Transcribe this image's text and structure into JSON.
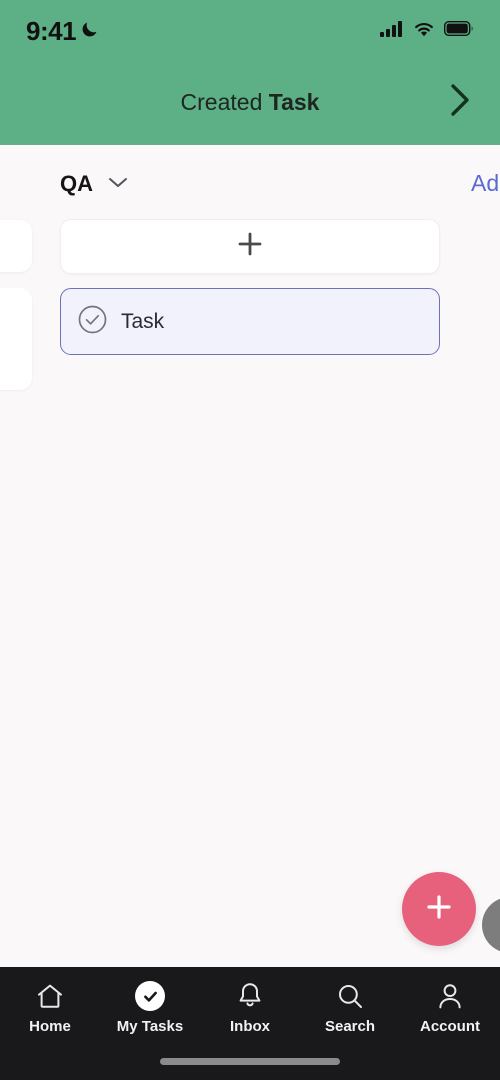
{
  "status_bar": {
    "time": "9:41",
    "moon_icon": "crescent-moon-icon",
    "cellular_icon": "cellular-signal-icon",
    "wifi_icon": "wifi-icon",
    "battery_icon": "battery-full-icon"
  },
  "header": {
    "title_prefix": "Created ",
    "title_emphasis": "Task",
    "chevron_icon": "chevron-right-icon",
    "background_color": "#5daf86"
  },
  "list_header": {
    "section_label": "QA",
    "caret_icon": "chevron-down-icon",
    "add_label": "Add",
    "add_color": "#5b6ad0"
  },
  "board": {
    "add_card": {
      "icon": "plus-icon",
      "label": ""
    },
    "task_card": {
      "label": "Task",
      "status_icon": "check-circle-icon",
      "selected": true,
      "border_color": "#6b72b8",
      "fill_color": "#f2f2fc"
    }
  },
  "fab": {
    "icon": "plus-icon",
    "color": "#e8617c",
    "secondary_color": "#7d7d7d"
  },
  "bottom_nav": {
    "background_color": "#19191c",
    "items": [
      {
        "label": "Home",
        "icon": "home-icon",
        "active": false
      },
      {
        "label": "My Tasks",
        "icon": "check-circle-filled-icon",
        "active": true
      },
      {
        "label": "Inbox",
        "icon": "bell-icon",
        "active": false
      },
      {
        "label": "Search",
        "icon": "search-icon",
        "active": false
      },
      {
        "label": "Account",
        "icon": "person-icon",
        "active": false
      }
    ]
  }
}
